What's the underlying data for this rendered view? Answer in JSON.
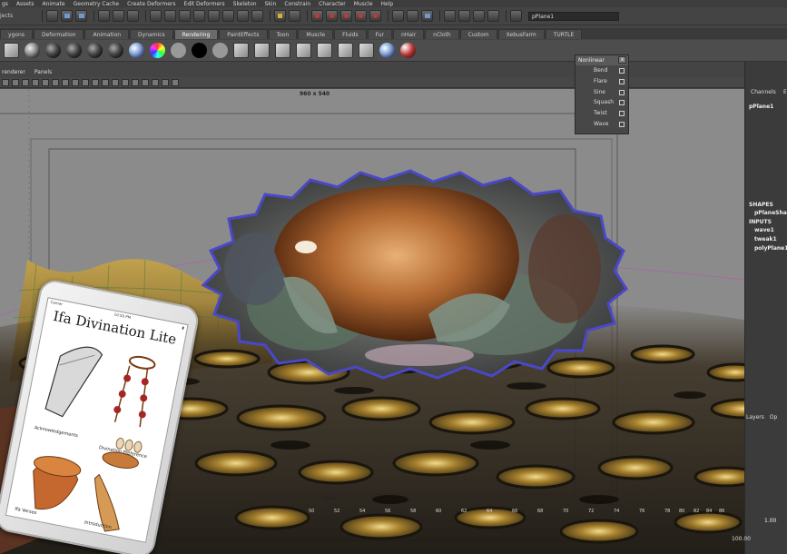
{
  "menubar": {
    "items": [
      "gs",
      "Assets",
      "Animate",
      "Geometry Cache",
      "Create Deformers",
      "Edit Deformers",
      "Skeleton",
      "Skin",
      "Constrain",
      "Character",
      "Muscle",
      "Help"
    ]
  },
  "statusline": {
    "label": "jects",
    "object_field": "pPlane1"
  },
  "shelf_tabs": {
    "items": [
      "ygons",
      "Deformation",
      "Animation",
      "Dynamics",
      "Rendering",
      "PaintEffects",
      "Toon",
      "Muscle",
      "Fluids",
      "Fur",
      "nHair",
      "nCloth",
      "Custom",
      "XebusFarm",
      "TURTLE"
    ],
    "active": "Rendering"
  },
  "panel_menu": {
    "items": [
      "renderer",
      "Panels"
    ]
  },
  "viewport": {
    "resolution_gate": "960 x 540",
    "camera_label": "persp"
  },
  "nonlinear_menu": {
    "title": "Nonlinear",
    "close": "x",
    "items": [
      "Bend",
      "Flare",
      "Sine",
      "Squash",
      "Twist",
      "Wave"
    ]
  },
  "channel_box": {
    "tab_channels": "Channels",
    "tab_edit": "E",
    "object_name": "pPlane1",
    "shapes_label": "SHAPES",
    "shape_name": "pPlaneSha",
    "inputs_label": "INPUTS",
    "inputs": [
      "wave1",
      "tweak1",
      "polyPlane1"
    ]
  },
  "layers": {
    "tabs": [
      "Layers",
      "Op"
    ]
  },
  "timeline": {
    "ticks": [
      "50",
      "52",
      "54",
      "56",
      "58",
      "60",
      "62",
      "64",
      "66",
      "68",
      "70",
      "72",
      "74",
      "76",
      "78",
      "80",
      "82",
      "84",
      "86"
    ],
    "range_end": "1.00",
    "range_value": "100.00"
  },
  "phone": {
    "carrier": "Carrier",
    "time": "10:56 PM",
    "app_title": "Ifa Divination Lite",
    "label_acknowledgements": "Acknowledgements",
    "label_divination": "Divination Preference",
    "label_ifa": "Ifa Verses",
    "label_intro": "Introduction"
  }
}
